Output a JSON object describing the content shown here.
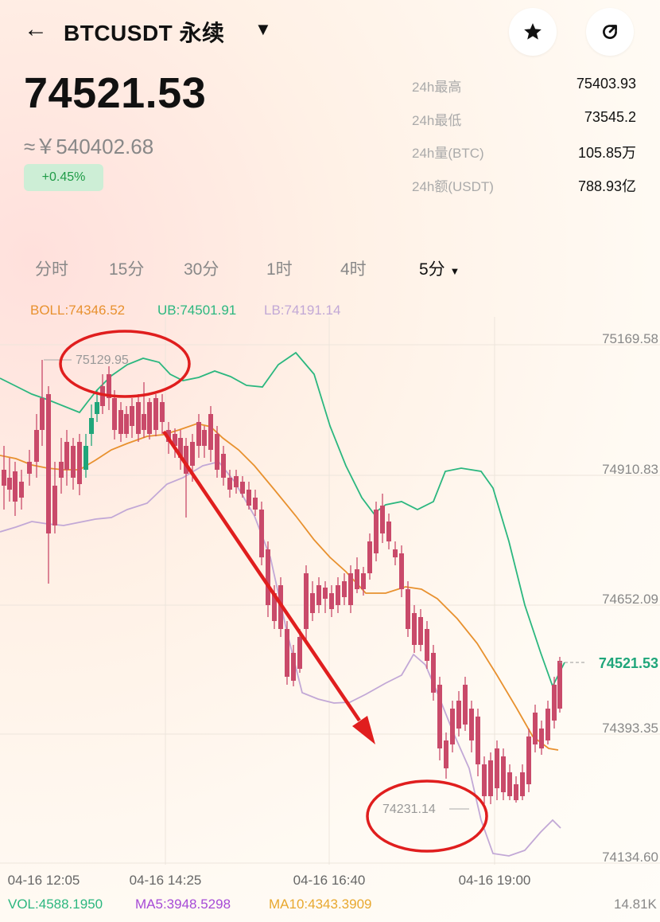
{
  "header": {
    "back_icon": "arrow-left-icon",
    "title": "BTCUSDT 永续",
    "dropdown_icon": "caret-down-icon",
    "star_icon": "star-icon",
    "share_icon": "refresh-share-icon"
  },
  "ticker": {
    "last_price": "74521.53",
    "cny_price": "≈￥540402.68",
    "change": "+0.45%",
    "stats": [
      {
        "label": "24h最高",
        "value": "75403.93"
      },
      {
        "label": "24h最低",
        "value": "73545.2"
      },
      {
        "label": "24h量(BTC)",
        "value": "105.85万"
      },
      {
        "label": "24h额(USDT)",
        "value": "788.93亿"
      }
    ]
  },
  "timeframes": {
    "tabs": [
      "分时",
      "15分",
      "30分",
      "1时",
      "4时"
    ],
    "selected": "5分"
  },
  "indicators": {
    "boll": "BOLL:74346.52",
    "ub": "UB:74501.91",
    "lb": "LB:74191.14",
    "vol": "VOL:4588.1950",
    "ma5": "MA5:3948.5298",
    "ma10": "MA10:4343.3909",
    "vol_axis": "14.81K"
  },
  "chart": {
    "price_labels": [
      "75169.58",
      "74910.83",
      "74652.09",
      "74393.35",
      "74134.60"
    ],
    "current_price_label": "74521.53",
    "high_marker": "75129.95",
    "low_marker": "74231.14",
    "time_labels": [
      "04-16 12:05",
      "04-16 14:25",
      "04-16 16:40",
      "04-16 19:00"
    ]
  },
  "colors": {
    "up": "#1fa67a",
    "down": "#c94a6a",
    "boll_mid": "#e8912f",
    "boll_upper": "#2bb77f",
    "boll_lower": "#c2a8d6",
    "annotation": "#e01e1e"
  }
}
